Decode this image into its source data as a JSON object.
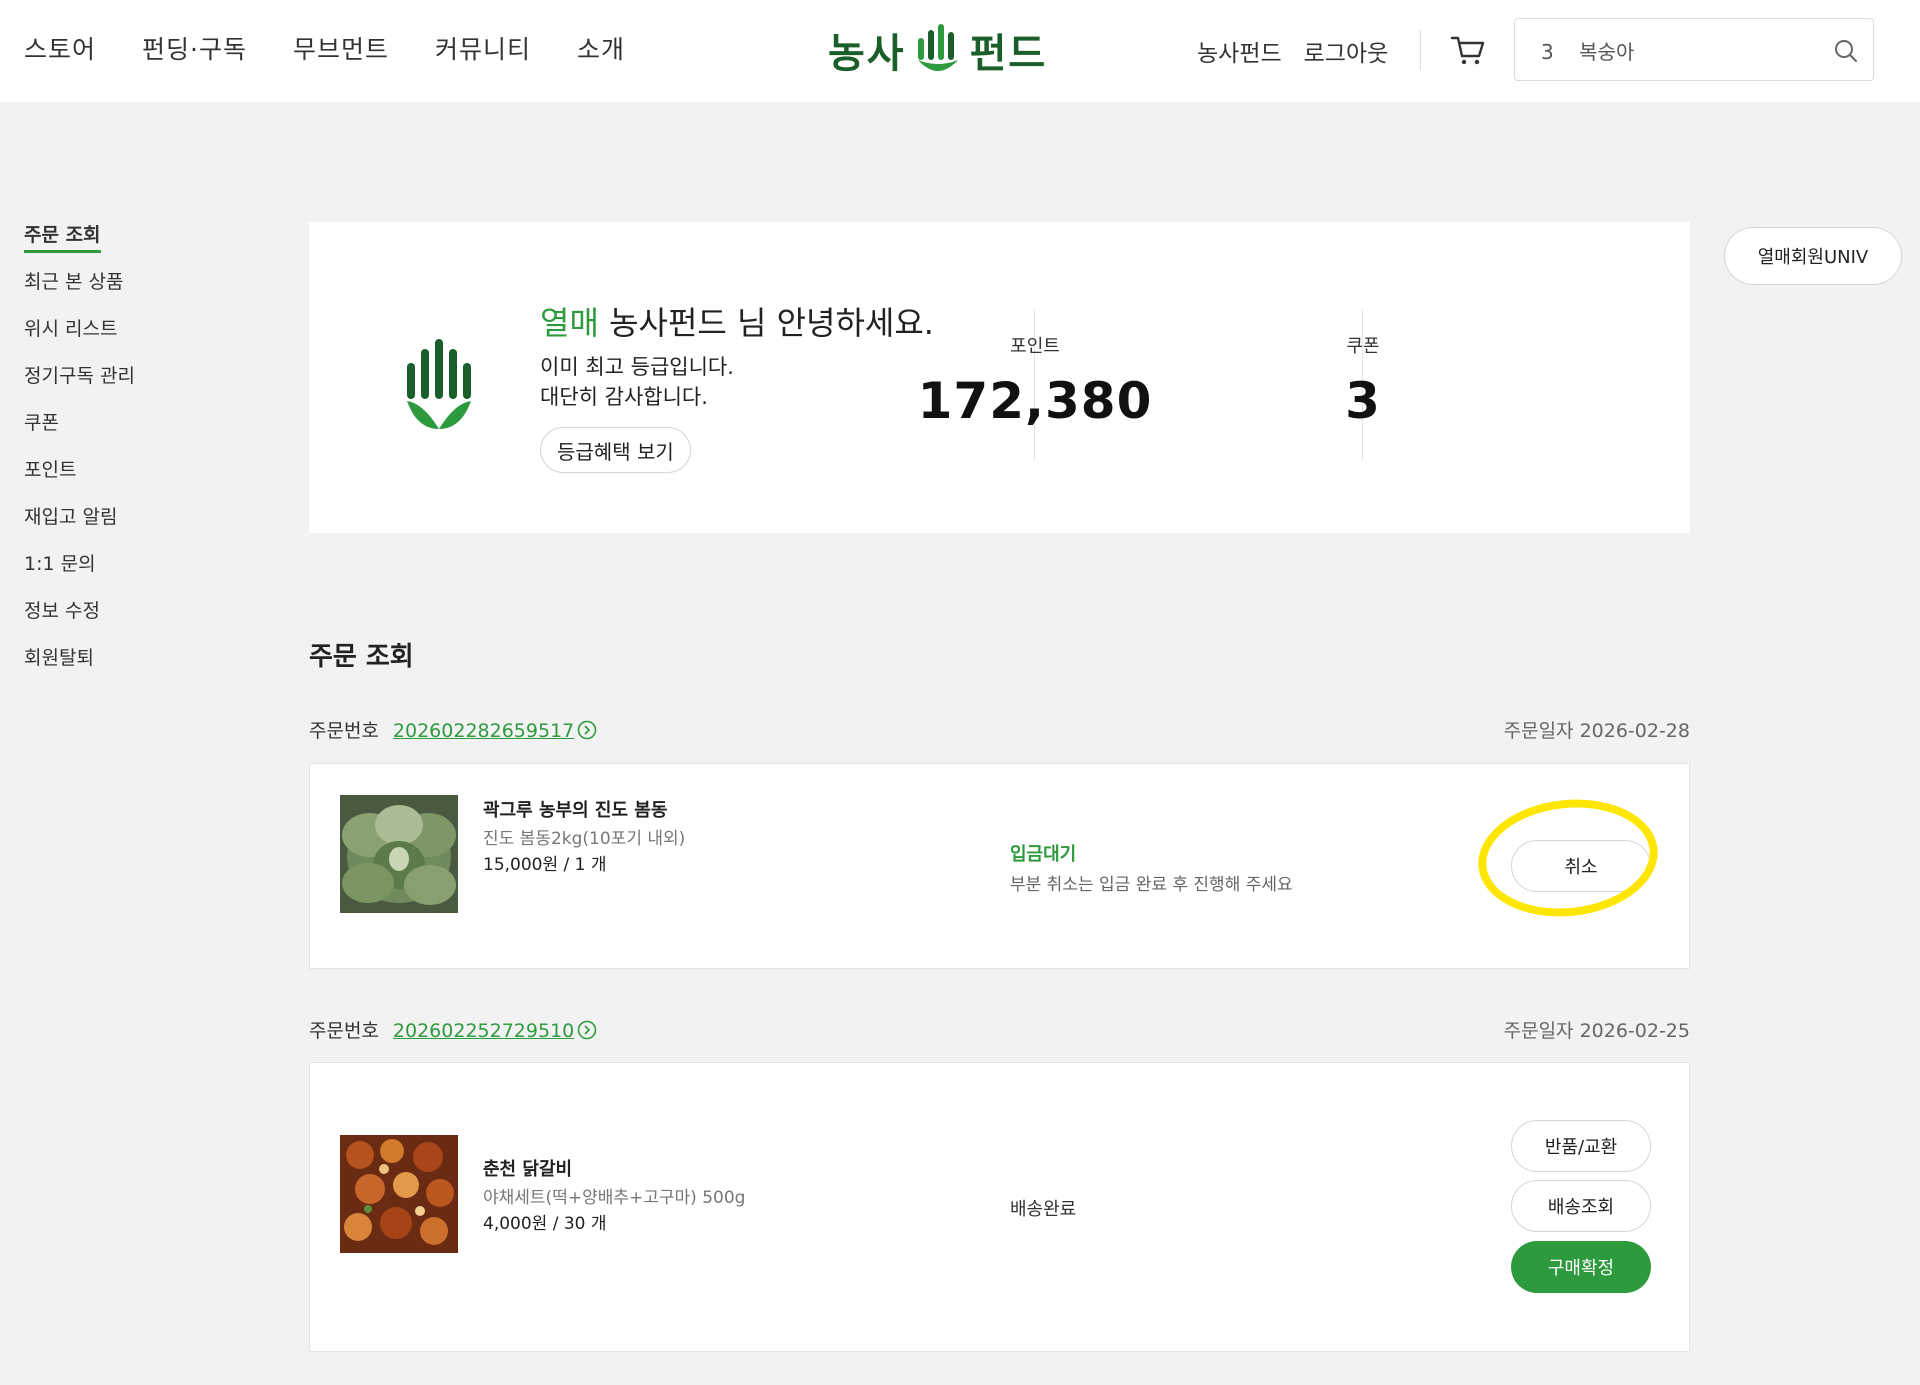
{
  "header": {
    "nav": [
      "스토어",
      "펀딩·구독",
      "무브먼트",
      "커뮤니티",
      "소개"
    ],
    "logo_text_left": "농사",
    "logo_text_right": "펀드",
    "user_name": "농사펀드",
    "logout": "로그아웃",
    "search_value": "3    복숭아"
  },
  "sidebar": {
    "items": [
      "주문 조회",
      "최근 본 상품",
      "위시 리스트",
      "정기구독 관리",
      "쿠폰",
      "포인트",
      "재입고 알림",
      "1:1 문의",
      "정보 수정",
      "회원탈퇴"
    ]
  },
  "profile": {
    "grade": "열매",
    "greeting": " 농사펀드 님 안녕하세요.",
    "line1": "이미 최고 등급입니다.",
    "line2": "대단히 감사합니다.",
    "benefit_button": "등급혜택 보기",
    "point_label": "포인트",
    "point_value": "172,380",
    "coupon_label": "쿠폰",
    "coupon_value": "3",
    "univ_button": "열매회원UNIV"
  },
  "orders_title": "주문 조회",
  "orders": [
    {
      "no_label": "주문번호",
      "no": "202602282659517",
      "date": "주문일자 2026-02-28",
      "name": "곽그루 농부의 진도 봄동",
      "option": "진도 봄동2kg(10포기 내외)",
      "price": "15,000원 / 1 개",
      "status": "입금대기",
      "status_note": "부분 취소는 입금 완료 후 진행해 주세요",
      "buttons": [
        "취소"
      ]
    },
    {
      "no_label": "주문번호",
      "no": "202602252729510",
      "date": "주문일자 2026-02-25",
      "name": "춘천 닭갈비",
      "option": "야채세트(떡+양배추+고구마) 500g",
      "price": "4,000원 / 30 개",
      "status": "배송완료",
      "buttons": [
        "반품/교환",
        "배송조회",
        "구매확정"
      ]
    }
  ],
  "colors": {
    "brand_green": "#2e9a3e",
    "logo_green": "#1a5e2a",
    "highlight": "#ffe600"
  }
}
